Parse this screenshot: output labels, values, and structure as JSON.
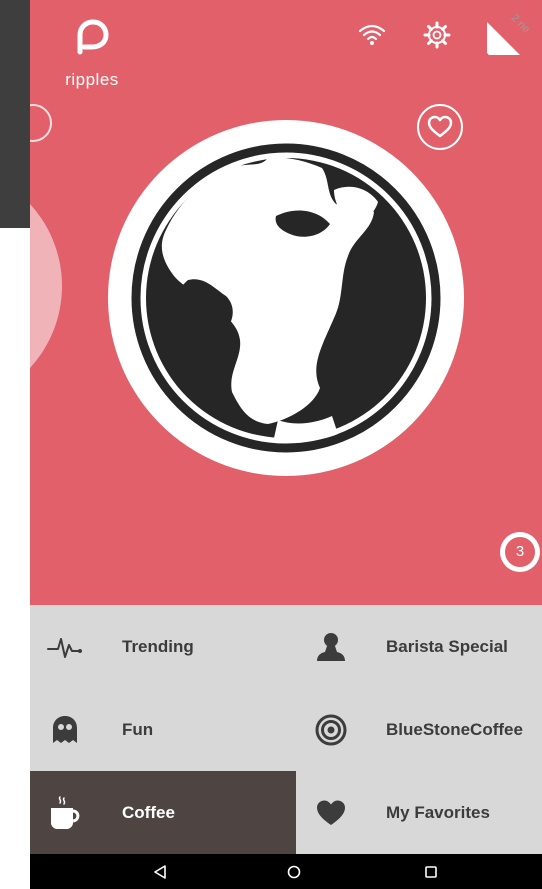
{
  "app": {
    "logo_text": "ripples",
    "corner_banner": "2 ne",
    "badge_count": "3"
  },
  "colors": {
    "hero": "#e2606a",
    "menu_bg": "#d8d8d8",
    "menu_active": "#4e4543",
    "dark_panel": "#3e3e3e"
  },
  "icons": {
    "status": [
      "wifi-icon",
      "gear-icon"
    ],
    "hero": [
      "heart-icon",
      "globe-icon"
    ]
  },
  "menu": {
    "items": [
      {
        "label": "Trending",
        "icon": "pulse-icon",
        "active": false
      },
      {
        "label": "Barista Special",
        "icon": "person-icon",
        "active": false
      },
      {
        "label": "Fun",
        "icon": "ghost-icon",
        "active": false
      },
      {
        "label": "BlueStoneCoffee",
        "icon": "target-icon",
        "active": false
      },
      {
        "label": "Coffee",
        "icon": "coffee-cup-icon",
        "active": true
      },
      {
        "label": "My Favorites",
        "icon": "heart-icon",
        "active": false
      }
    ]
  },
  "navbar": {
    "buttons": [
      "back-icon",
      "home-icon",
      "recents-icon"
    ]
  }
}
